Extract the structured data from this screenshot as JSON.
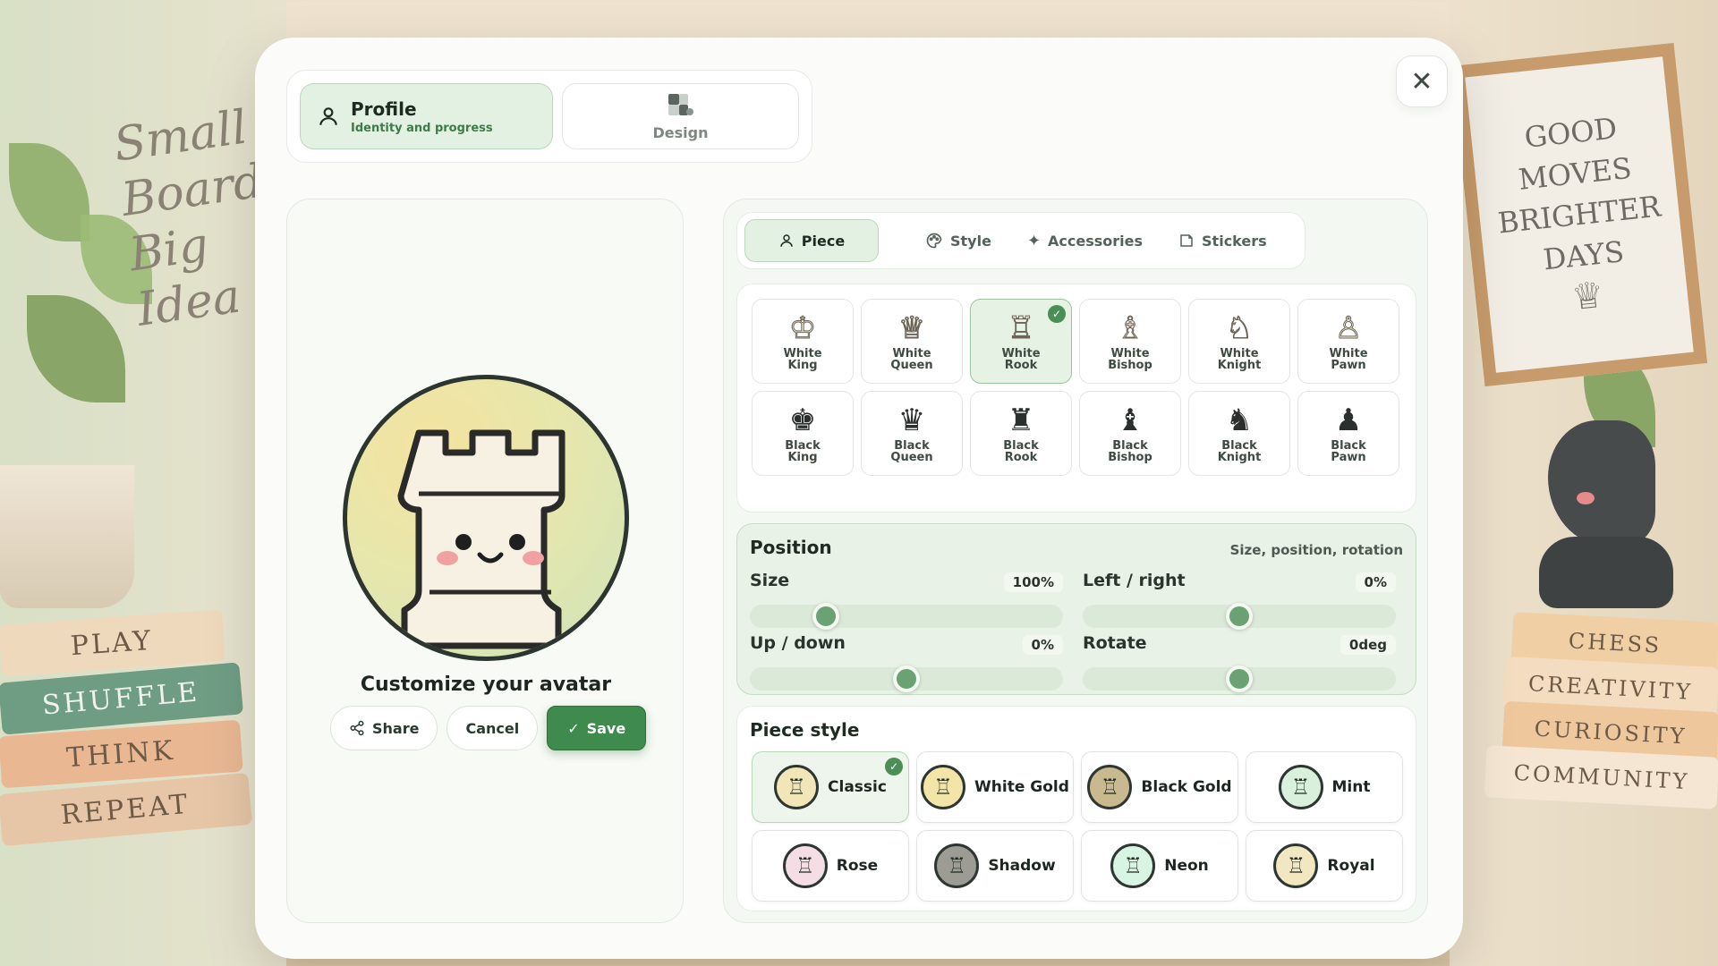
{
  "background": {
    "wall_text": [
      "Small",
      "Board",
      "Big",
      "Idea"
    ],
    "frame_text": [
      "GOOD",
      "MOVES",
      "BRIGHTER",
      "DAYS"
    ],
    "books_left": [
      "PLAY",
      "SHUFFLE",
      "THINK",
      "REPEAT"
    ],
    "books_right": [
      "CHESS",
      "CREATIVITY",
      "CURIOSITY",
      "COMMUNITY"
    ]
  },
  "close": {
    "glyph": "✕"
  },
  "top_tabs": {
    "profile": {
      "title": "Profile",
      "subtitle": "Identity and progress",
      "icon": "user-icon"
    },
    "design": {
      "label": "Design",
      "icon": "design-icon"
    }
  },
  "preview": {
    "title": "Customize your avatar",
    "share_label": "Share",
    "cancel_label": "Cancel",
    "save_label": "Save"
  },
  "sub_tabs": [
    {
      "label": "Piece",
      "icon": "user-icon",
      "active": true
    },
    {
      "label": "Style",
      "icon": "palette-icon",
      "active": false
    },
    {
      "label": "Accessories",
      "icon": "sparkles-icon",
      "active": false
    },
    {
      "label": "Stickers",
      "icon": "sticker-icon",
      "active": false
    }
  ],
  "pieces": [
    {
      "line1": "White",
      "line2": "King",
      "glyph": "♔",
      "color": "white"
    },
    {
      "line1": "White",
      "line2": "Queen",
      "glyph": "♕",
      "color": "white"
    },
    {
      "line1": "White",
      "line2": "Rook",
      "glyph": "♖",
      "color": "white",
      "selected": true
    },
    {
      "line1": "White",
      "line2": "Bishop",
      "glyph": "♗",
      "color": "white"
    },
    {
      "line1": "White",
      "line2": "Knight",
      "glyph": "♘",
      "color": "white"
    },
    {
      "line1": "White",
      "line2": "Pawn",
      "glyph": "♙",
      "color": "white"
    },
    {
      "line1": "Black",
      "line2": "King",
      "glyph": "♚",
      "color": "black"
    },
    {
      "line1": "Black",
      "line2": "Queen",
      "glyph": "♛",
      "color": "black"
    },
    {
      "line1": "Black",
      "line2": "Rook",
      "glyph": "♜",
      "color": "black"
    },
    {
      "line1": "Black",
      "line2": "Bishop",
      "glyph": "♝",
      "color": "black"
    },
    {
      "line1": "Black",
      "line2": "Knight",
      "glyph": "♞",
      "color": "black"
    },
    {
      "line1": "Black",
      "line2": "Pawn",
      "glyph": "♟",
      "color": "black"
    }
  ],
  "position": {
    "title": "Position",
    "hint": "Size, position, rotation",
    "sliders": {
      "size": {
        "label": "Size",
        "value": "100%",
        "fraction": 0.22
      },
      "left_right": {
        "label": "Left / right",
        "value": "0%",
        "fraction": 0.5
      },
      "up_down": {
        "label": "Up / down",
        "value": "0%",
        "fraction": 0.5
      },
      "rotate": {
        "label": "Rotate",
        "value": "0deg",
        "fraction": 0.5
      }
    }
  },
  "piece_style": {
    "title": "Piece style",
    "options": [
      {
        "name": "Classic",
        "tint": "#f2e6b8",
        "selected": true
      },
      {
        "name": "White Gold",
        "tint": "#f3e4a8"
      },
      {
        "name": "Black Gold",
        "tint": "#c9b98f"
      },
      {
        "name": "Mint",
        "tint": "#d8f0dc"
      },
      {
        "name": "Rose",
        "tint": "#f4dde4"
      },
      {
        "name": "Shadow",
        "tint": "#9c9c94"
      },
      {
        "name": "Neon",
        "tint": "#d8f4e2"
      },
      {
        "name": "Royal",
        "tint": "#f1e7c0"
      }
    ]
  },
  "colors": {
    "accent": "#3f8a4d",
    "accent_light": "#e3f1e2"
  }
}
